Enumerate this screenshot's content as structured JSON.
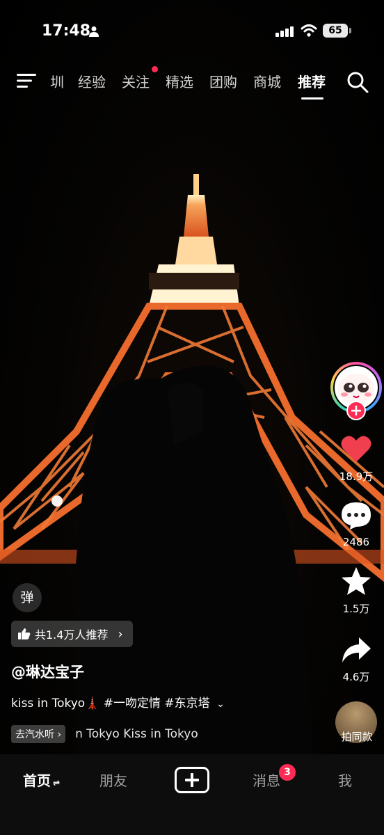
{
  "status_bar": {
    "time": "17:48",
    "battery": "65"
  },
  "top_nav": {
    "tabs": [
      "圳",
      "经验",
      "关注",
      "精选",
      "团购",
      "商城",
      "推荐"
    ],
    "active_tab": "推荐"
  },
  "actions": {
    "like_count": "18.9万",
    "comment_count": "2486",
    "favorite_count": "1.5万",
    "share_count": "4.6万",
    "same_style_label": "拍同款"
  },
  "overlay": {
    "danmu_label": "弹",
    "recommend_text": "共1.4万人推荐",
    "author": "@琳达宝子",
    "caption": "kiss in Tokyo🗼 #一吻定情 #东京塔",
    "music_tag": "去汽水听",
    "music_title": "n Tokyo   Kiss in Tokyo"
  },
  "bottom_nav": {
    "home": "首页",
    "friends": "朋友",
    "messages": "消息",
    "messages_badge": "3",
    "me": "我"
  },
  "colors": {
    "accent": "#fe2c55",
    "tower": "#e8692b",
    "background": "#000000"
  }
}
